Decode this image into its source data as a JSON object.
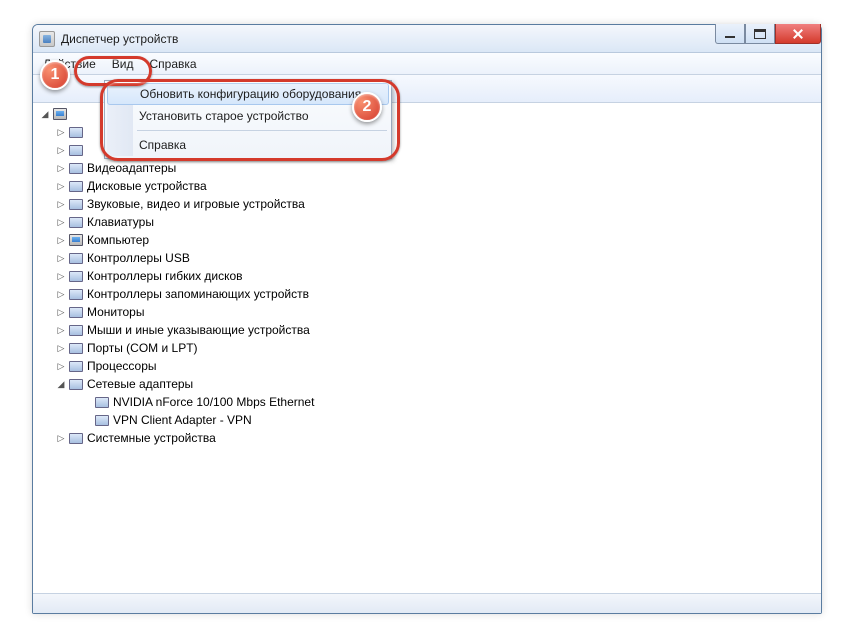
{
  "window": {
    "title": "Диспетчер устройств"
  },
  "menubar": {
    "action": "Действие",
    "view": "Вид",
    "help": "Справка"
  },
  "dropdown": {
    "scan_hardware": "Обновить конфигурацию оборудования",
    "add_legacy": "Установить старое устройство",
    "help": "Справка"
  },
  "tree": {
    "items": [
      {
        "label": "",
        "indent": 1,
        "expander": "▷",
        "icon": "dev"
      },
      {
        "label": "",
        "indent": 1,
        "expander": "▷",
        "icon": "dev"
      },
      {
        "label": "Видеоадаптеры",
        "indent": 1,
        "expander": "▷",
        "icon": "dev"
      },
      {
        "label": "Дисковые устройства",
        "indent": 1,
        "expander": "▷",
        "icon": "dev"
      },
      {
        "label": "Звуковые, видео и игровые устройства",
        "indent": 1,
        "expander": "▷",
        "icon": "dev"
      },
      {
        "label": "Клавиатуры",
        "indent": 1,
        "expander": "▷",
        "icon": "dev"
      },
      {
        "label": "Компьютер",
        "indent": 1,
        "expander": "▷",
        "icon": "pc"
      },
      {
        "label": "Контроллеры USB",
        "indent": 1,
        "expander": "▷",
        "icon": "dev"
      },
      {
        "label": "Контроллеры гибких дисков",
        "indent": 1,
        "expander": "▷",
        "icon": "dev"
      },
      {
        "label": "Контроллеры запоминающих устройств",
        "indent": 1,
        "expander": "▷",
        "icon": "dev"
      },
      {
        "label": "Мониторы",
        "indent": 1,
        "expander": "▷",
        "icon": "dev"
      },
      {
        "label": "Мыши и иные указывающие устройства",
        "indent": 1,
        "expander": "▷",
        "icon": "dev"
      },
      {
        "label": "Порты (COM и LPT)",
        "indent": 1,
        "expander": "▷",
        "icon": "dev"
      },
      {
        "label": "Процессоры",
        "indent": 1,
        "expander": "▷",
        "icon": "dev"
      },
      {
        "label": "Сетевые адаптеры",
        "indent": 1,
        "expander": "◢",
        "icon": "dev"
      },
      {
        "label": "NVIDIA nForce 10/100 Mbps Ethernet",
        "indent": 2,
        "expander": "",
        "icon": "dev"
      },
      {
        "label": "VPN Client Adapter - VPN",
        "indent": 2,
        "expander": "",
        "icon": "dev"
      },
      {
        "label": "Системные устройства",
        "indent": 1,
        "expander": "▷",
        "icon": "dev"
      }
    ]
  },
  "callouts": {
    "b1": "1",
    "b2": "2"
  }
}
